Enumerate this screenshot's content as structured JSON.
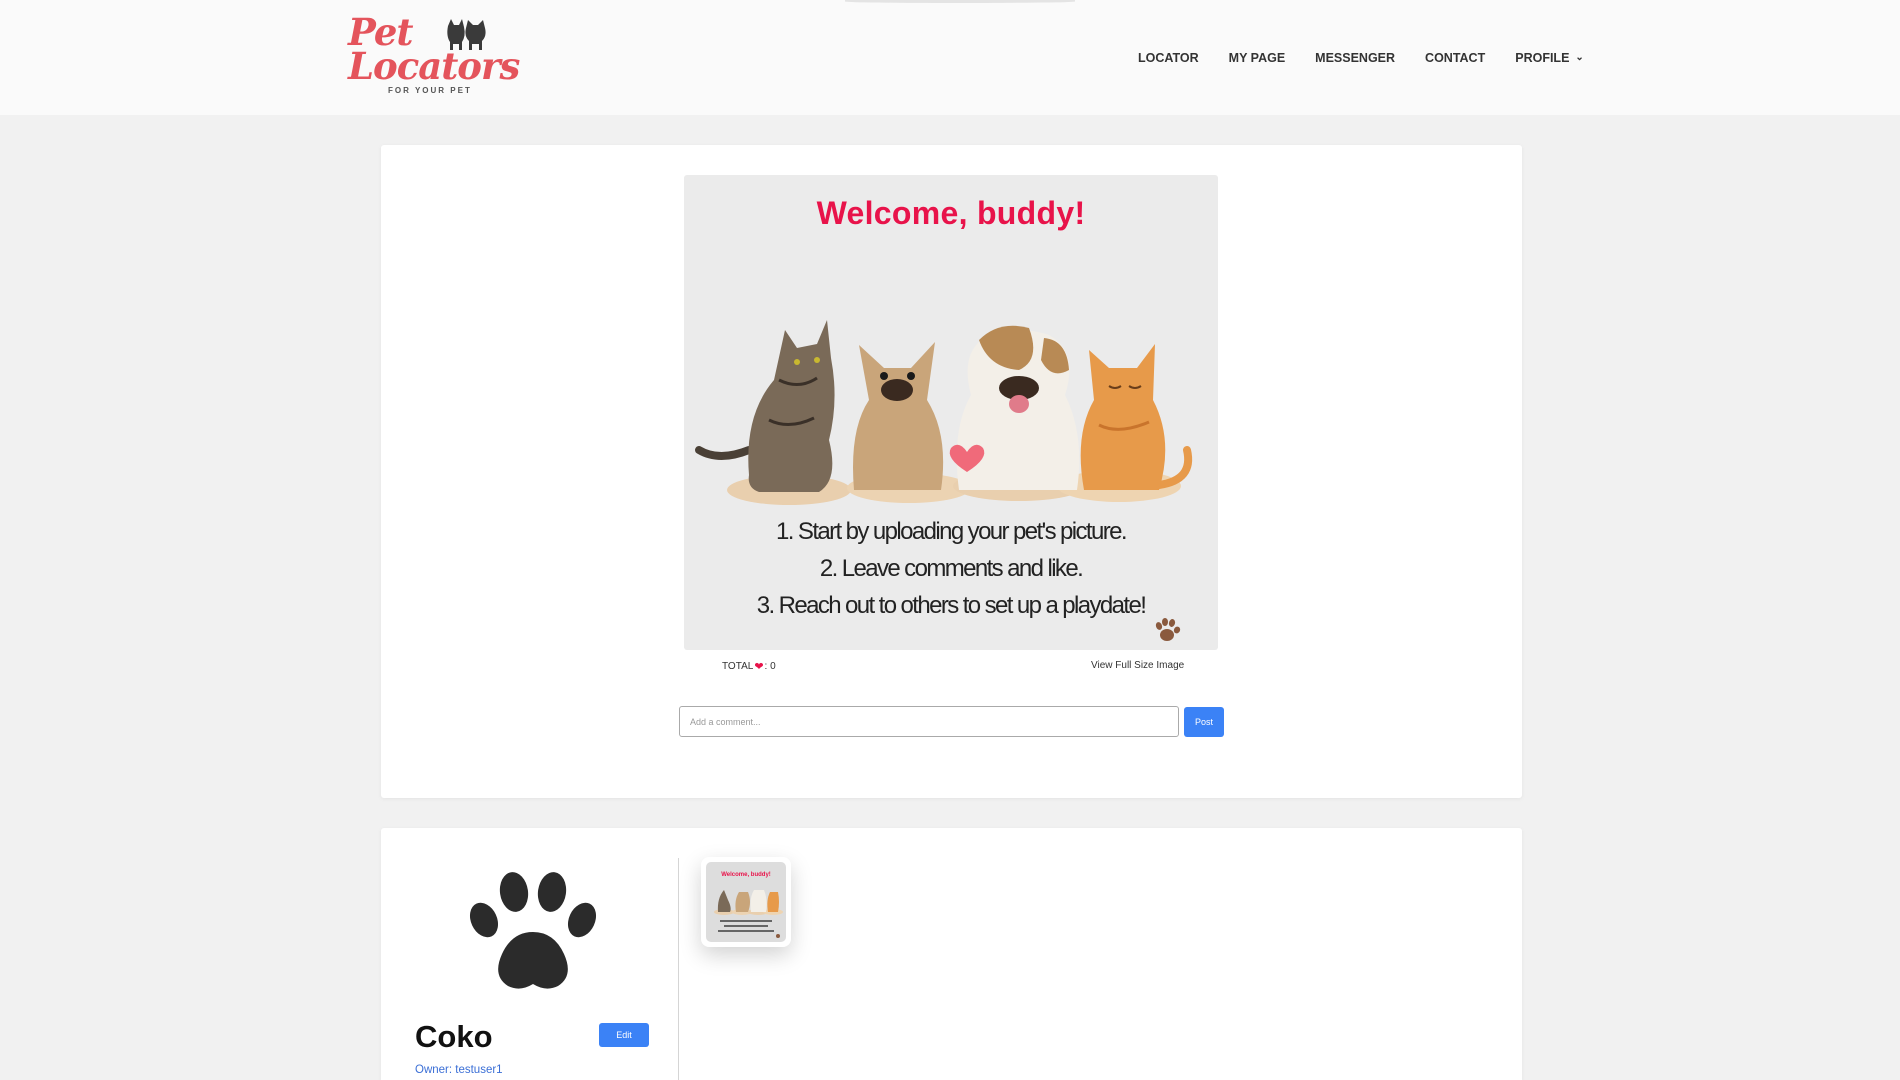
{
  "brand": {
    "name_line1": "Pet",
    "name_line2": "Locators",
    "tagline": "FOR YOUR PET"
  },
  "nav": {
    "items": [
      "LOCATOR",
      "MY PAGE",
      "MESSENGER",
      "CONTACT",
      "PROFILE"
    ],
    "profile_chevron": "chevron-down-icon"
  },
  "post": {
    "image": {
      "heading": "Welcome, buddy!",
      "steps": [
        "1.  Start by uploading your pet's picture.",
        "2.  Leave comments and like.",
        "3.  Reach out to others to set up a playdate!"
      ]
    },
    "total_label": "TOTAL",
    "total_suffix": ": 0",
    "likes": 0,
    "view_full_label": "View Full Size Image",
    "comment_placeholder": "Add a comment...",
    "comment_value": "",
    "post_label": "Post"
  },
  "profile": {
    "pet_name": "Coko",
    "edit_label": "Edit",
    "owner": "Owner: testuser1",
    "thumb_heading": "Welcome, buddy!"
  },
  "colors": {
    "brand_red": "#e4545c",
    "heading_pink": "#e8134a",
    "button_blue": "#3b82f6",
    "owner_link": "#3b6fd6"
  }
}
